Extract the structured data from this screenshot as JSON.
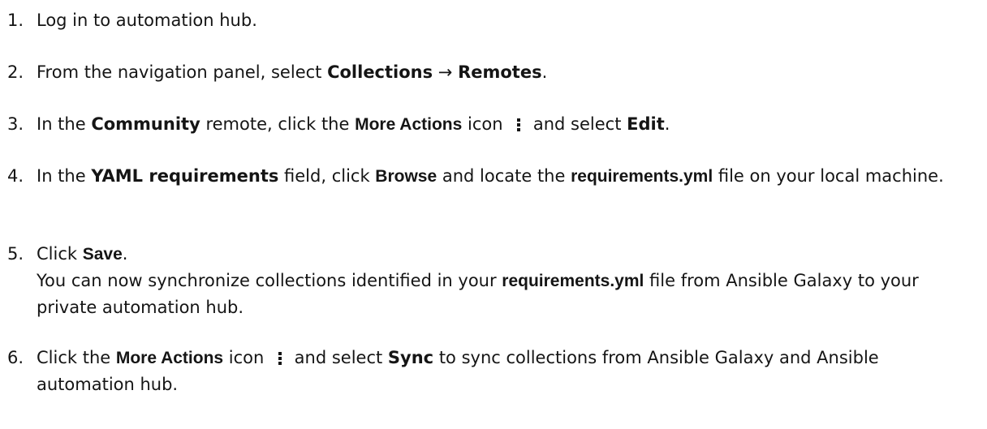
{
  "steps": [
    {
      "num": "1.",
      "parts": [
        {
          "t": "Log in to automation hub."
        }
      ]
    },
    {
      "num": "2.",
      "parts": [
        {
          "t": "From the navigation panel, select "
        },
        {
          "t": "Collections",
          "k": "gui"
        },
        {
          "t": " → "
        },
        {
          "t": "Remotes",
          "k": "gui"
        },
        {
          "t": "."
        }
      ]
    },
    {
      "num": "3.",
      "parts": [
        {
          "t": "In the "
        },
        {
          "t": "Community",
          "k": "gui"
        },
        {
          "t": " remote, click the "
        },
        {
          "t": "More Actions",
          "k": "strong"
        },
        {
          "t": " icon "
        },
        {
          "k": "icon",
          "icon": "more-actions-kebab-icon"
        },
        {
          "t": " and select "
        },
        {
          "t": "Edit",
          "k": "gui"
        },
        {
          "t": "."
        }
      ]
    },
    {
      "num": "4.",
      "parts": [
        {
          "t": "In the "
        },
        {
          "t": "YAML requirements",
          "k": "gui"
        },
        {
          "t": " field, click "
        },
        {
          "t": "Browse",
          "k": "strong"
        },
        {
          "t": " and locate the "
        },
        {
          "t": "requirements.yml",
          "k": "strong"
        },
        {
          "t": " file on your local machine."
        }
      ]
    },
    {
      "num": "5.",
      "parts": [
        {
          "t": "Click "
        },
        {
          "t": "Save",
          "k": "strong"
        },
        {
          "t": "."
        },
        {
          "k": "br"
        },
        {
          "t": "You can now synchronize collections identified in your "
        },
        {
          "t": "requirements.yml",
          "k": "strong"
        },
        {
          "t": " file from Ansible Galaxy to your private automation hub."
        }
      ]
    },
    {
      "num": "6.",
      "parts": [
        {
          "t": "Click the "
        },
        {
          "t": "More Actions",
          "k": "strong"
        },
        {
          "t": " icon "
        },
        {
          "k": "icon",
          "icon": "more-actions-kebab-icon"
        },
        {
          "t": " and select "
        },
        {
          "t": "Sync",
          "k": "gui"
        },
        {
          "t": " to sync collections from Ansible Galaxy and Ansible automation hub."
        }
      ]
    }
  ]
}
